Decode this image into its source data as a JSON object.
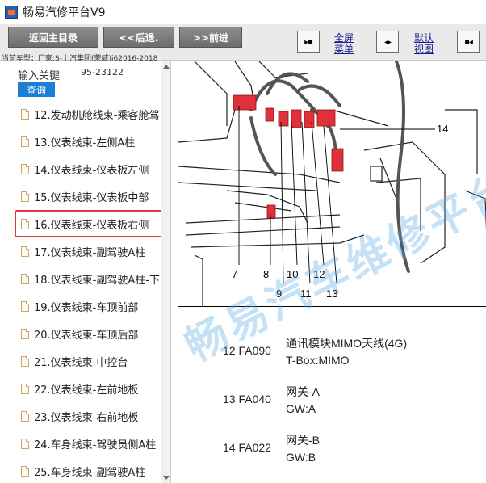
{
  "window": {
    "title": "畅易汽修平台V9"
  },
  "toolbar": {
    "home_label": "返回主目录",
    "back_label": "<<后退.",
    "forward_label": ">>前进",
    "fullscreen_label_1": "全屏",
    "fullscreen_label_2": "菜单",
    "default_view_label_1": "默认",
    "default_view_label_2": "视图",
    "car_info": "当前车型：厂家:S-上汽集团(荣威)i62016-2018"
  },
  "sidebar": {
    "search_label": "输入关键",
    "search_value": "95-23122",
    "search_button": "查询",
    "items": [
      "12.发动机舱线束-乘客舱驾",
      "13.仪表线束-左侧A柱",
      "14.仪表线束-仪表板左侧",
      "15.仪表线束-仪表板中部",
      "16.仪表线束-仪表板右侧",
      "17.仪表线束-副驾驶A柱",
      "18.仪表线束-副驾驶A柱-下",
      "19.仪表线束-车顶前部",
      "20.仪表线束-车顶后部",
      "21.仪表线束-中控台",
      "22.仪表线束-左前地板",
      "23.仪表线束-右前地板",
      "24.车身线束-驾驶员侧A柱",
      "25.车身线束-副驾驶A柱"
    ],
    "selected_index": 4
  },
  "diagram": {
    "callouts": [
      "14",
      "7",
      "8",
      "9",
      "10",
      "11",
      "12",
      "13"
    ]
  },
  "legend": [
    {
      "code": "12 FA090",
      "line1": "通讯模块MIMO天线(4G)",
      "line2": "T-Box:MIMO"
    },
    {
      "code": "13 FA040",
      "line1": "网关-A",
      "line2": "GW:A"
    },
    {
      "code": "14 FA022",
      "line1": "网关-B",
      "line2": "GW:B"
    }
  ],
  "watermark": "畅易汽车维修平台",
  "colors": {
    "toolbar_button": "#7a7a7a",
    "search_button": "#1a7fd2",
    "selection_border": "#e0393e",
    "connector_red": "#e0303a"
  }
}
